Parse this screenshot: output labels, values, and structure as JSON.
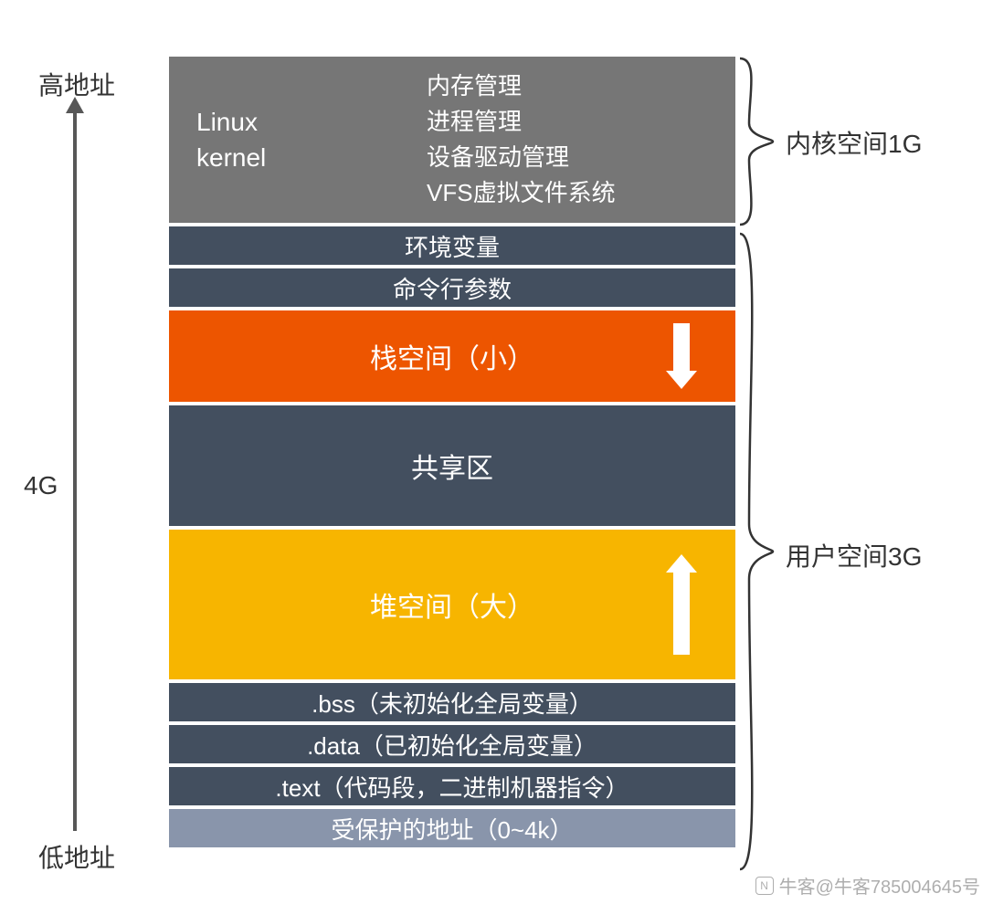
{
  "left": {
    "high": "高地址",
    "low": "低地址",
    "total": "4G"
  },
  "right": {
    "kernel_space": "内核空间1G",
    "user_space": "用户空间3G"
  },
  "kernel": {
    "title_line1": "Linux",
    "title_line2": "kernel",
    "items": [
      "内存管理",
      "进程管理",
      "设备驱动管理",
      "VFS虚拟文件系统"
    ]
  },
  "segments": {
    "env": "环境变量",
    "argv": "命令行参数",
    "stack": "栈空间（小）",
    "shared": "共享区",
    "heap": "堆空间（大）",
    "bss": ".bss（未初始化全局变量）",
    "data": ".data（已初始化全局变量）",
    "text": ".text（代码段，二进制机器指令）",
    "protected": "受保护的地址（0~4k）"
  },
  "watermark": "牛客@牛客785004645号",
  "colors": {
    "gray": "#767676",
    "slate": "#434f5f",
    "orange": "#ed5500",
    "yellow": "#f7b500",
    "light": "#8995ab"
  }
}
